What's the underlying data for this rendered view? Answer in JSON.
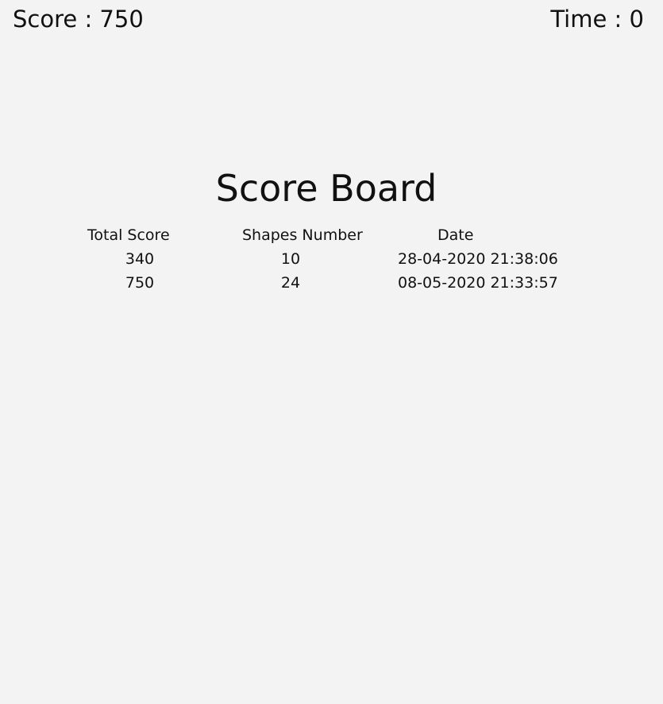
{
  "hud": {
    "score_text": "Score : 750",
    "time_text": "Time : 0"
  },
  "scoreboard": {
    "title": "Score Board",
    "columns": [
      "Total Score",
      "Shapes Number",
      "Date"
    ],
    "rows": [
      {
        "total_score": "340",
        "shapes_number": "10",
        "date": "28-04-2020 21:38:06"
      },
      {
        "total_score": "750",
        "shapes_number": "24",
        "date": "08-05-2020 21:33:57"
      }
    ]
  },
  "colors": {
    "background": "#f3f3f3",
    "text": "#111111"
  }
}
